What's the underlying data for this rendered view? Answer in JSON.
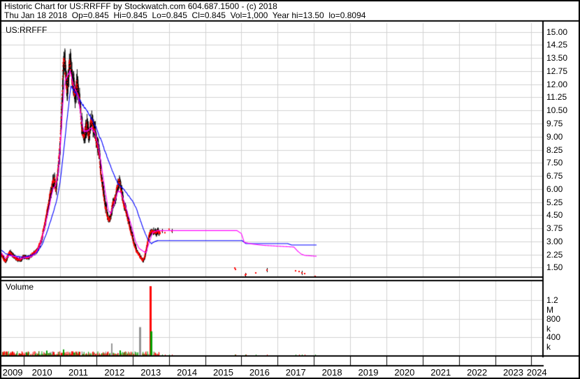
{
  "header": {
    "title": "Historic Chart for US:RRFFF by Stockwatch.com 604.687.1500 - (c) 2018",
    "quote_line": "Thu Jan 18 2018  Op=0.845  Hi=0.845  Lo=0.845  Cl=0.845  Vol=1,000  Year hi=13.50  lo=0.8094"
  },
  "chart": {
    "symbol_label": "US:RRFFF",
    "volume_label": "Volume"
  },
  "chart_data": {
    "type": "ohlc-with-volume",
    "symbol": "US:RRFFF",
    "grid": true,
    "xlim": [
      2009.38,
      2024.3
    ],
    "price_ylim": [
      1.0,
      15.5
    ],
    "volume_ylim": [
      0,
      1620000
    ],
    "years": [
      "2009",
      "2010",
      "2011",
      "2012",
      "2013",
      "2014",
      "2015",
      "2016",
      "2017",
      "2018",
      "2019",
      "2020",
      "2021",
      "2022",
      "2023",
      "2024"
    ],
    "price_ticks": [
      {
        "value": 15.0,
        "label": "15.00"
      },
      {
        "value": 14.25,
        "label": "14.25"
      },
      {
        "value": 13.5,
        "label": "13.50"
      },
      {
        "value": 12.75,
        "label": "12.75"
      },
      {
        "value": 12.0,
        "label": "12.00"
      },
      {
        "value": 11.25,
        "label": "11.25"
      },
      {
        "value": 10.5,
        "label": "10.50"
      },
      {
        "value": 9.75,
        "label": "9.75"
      },
      {
        "value": 9.0,
        "label": "9.00"
      },
      {
        "value": 8.25,
        "label": "8.25"
      },
      {
        "value": 7.5,
        "label": "7.50"
      },
      {
        "value": 6.75,
        "label": "6.75"
      },
      {
        "value": 6.0,
        "label": "6.00"
      },
      {
        "value": 5.25,
        "label": "5.25"
      },
      {
        "value": 4.5,
        "label": "4.50"
      },
      {
        "value": 3.75,
        "label": "3.75"
      },
      {
        "value": 3.0,
        "label": "3.00"
      },
      {
        "value": 2.25,
        "label": "2.25"
      },
      {
        "value": 1.5,
        "label": "1.50"
      }
    ],
    "volume_ticks": [
      {
        "value": 1200000,
        "label": "1.2 M"
      },
      {
        "value": 800000,
        "label": "800 k"
      },
      {
        "value": 400000,
        "label": "400 k"
      }
    ],
    "colors": {
      "bar": "#000000",
      "close_dot": "#ff0000",
      "ma_fast": "#ff00ff",
      "ma_slow": "#0000ff",
      "vol_up": "#00a000",
      "vol_down": "#ff0000",
      "vol_neutral": "#969696",
      "grid": "#d2d2d2",
      "border": "#000000"
    },
    "dense_range": [
      2009.38,
      2013.76
    ],
    "price_anchors": [
      [
        2009.38,
        2.3
      ],
      [
        2009.44,
        2.0
      ],
      [
        2009.5,
        1.85
      ],
      [
        2009.56,
        2.15
      ],
      [
        2009.62,
        2.4
      ],
      [
        2009.7,
        2.2
      ],
      [
        2009.8,
        2.0
      ],
      [
        2009.9,
        1.95
      ],
      [
        2010.0,
        2.15
      ],
      [
        2010.1,
        2.05
      ],
      [
        2010.2,
        2.2
      ],
      [
        2010.3,
        2.35
      ],
      [
        2010.4,
        2.6
      ],
      [
        2010.5,
        3.2
      ],
      [
        2010.6,
        4.3
      ],
      [
        2010.7,
        5.4
      ],
      [
        2010.78,
        6.3
      ],
      [
        2010.84,
        6.5
      ],
      [
        2010.88,
        5.9
      ],
      [
        2010.94,
        7.0
      ],
      [
        2011.0,
        8.8
      ],
      [
        2011.04,
        10.8
      ],
      [
        2011.08,
        12.8
      ],
      [
        2011.11,
        13.4
      ],
      [
        2011.15,
        12.3
      ],
      [
        2011.19,
        11.7
      ],
      [
        2011.24,
        12.9
      ],
      [
        2011.29,
        13.1
      ],
      [
        2011.34,
        12.1
      ],
      [
        2011.4,
        11.5
      ],
      [
        2011.46,
        12.1
      ],
      [
        2011.52,
        11.5
      ],
      [
        2011.57,
        10.3
      ],
      [
        2011.62,
        9.1
      ],
      [
        2011.67,
        8.8
      ],
      [
        2011.73,
        9.7
      ],
      [
        2011.79,
        9.1
      ],
      [
        2011.86,
        9.9
      ],
      [
        2011.93,
        9.4
      ],
      [
        2012.0,
        8.9
      ],
      [
        2012.08,
        7.7
      ],
      [
        2012.16,
        6.3
      ],
      [
        2012.24,
        5.1
      ],
      [
        2012.3,
        4.5
      ],
      [
        2012.36,
        4.1
      ],
      [
        2012.43,
        5.0
      ],
      [
        2012.5,
        5.4
      ],
      [
        2012.57,
        6.1
      ],
      [
        2012.63,
        6.5
      ],
      [
        2012.69,
        5.8
      ],
      [
        2012.76,
        5.2
      ],
      [
        2012.83,
        4.6
      ],
      [
        2012.9,
        4.0
      ],
      [
        2012.97,
        3.4
      ],
      [
        2013.05,
        2.8
      ],
      [
        2013.12,
        2.4
      ],
      [
        2013.2,
        2.15
      ],
      [
        2013.28,
        1.9
      ],
      [
        2013.34,
        2.2
      ],
      [
        2013.41,
        2.9
      ],
      [
        2013.47,
        3.4
      ],
      [
        2013.53,
        3.6
      ],
      [
        2013.6,
        3.5
      ],
      [
        2013.68,
        3.55
      ],
      [
        2013.76,
        3.5
      ]
    ],
    "ma_fast_magenta": [
      [
        2009.38,
        2.35
      ],
      [
        2009.5,
        2.05
      ],
      [
        2009.6,
        2.2
      ],
      [
        2009.75,
        2.15
      ],
      [
        2009.9,
        2.0
      ],
      [
        2010.05,
        2.08
      ],
      [
        2010.2,
        2.12
      ],
      [
        2010.32,
        2.3
      ],
      [
        2010.45,
        2.8
      ],
      [
        2010.58,
        3.8
      ],
      [
        2010.7,
        5.0
      ],
      [
        2010.8,
        6.0
      ],
      [
        2010.88,
        6.2
      ],
      [
        2010.95,
        6.9
      ],
      [
        2011.02,
        8.8
      ],
      [
        2011.08,
        11.0
      ],
      [
        2011.14,
        12.3
      ],
      [
        2011.2,
        12.5
      ],
      [
        2011.28,
        12.7
      ],
      [
        2011.35,
        12.1
      ],
      [
        2011.42,
        11.7
      ],
      [
        2011.5,
        11.3
      ],
      [
        2011.58,
        10.1
      ],
      [
        2011.65,
        9.3
      ],
      [
        2011.75,
        9.3
      ],
      [
        2011.85,
        9.5
      ],
      [
        2011.95,
        9.3
      ],
      [
        2012.05,
        8.5
      ],
      [
        2012.15,
        7.2
      ],
      [
        2012.25,
        5.8
      ],
      [
        2012.33,
        4.8
      ],
      [
        2012.4,
        4.6
      ],
      [
        2012.5,
        5.2
      ],
      [
        2012.6,
        5.9
      ],
      [
        2012.68,
        5.8
      ],
      [
        2012.78,
        5.2
      ],
      [
        2012.88,
        4.5
      ],
      [
        2012.98,
        3.8
      ],
      [
        2013.08,
        3.0
      ],
      [
        2013.18,
        2.6
      ],
      [
        2013.28,
        2.45
      ],
      [
        2013.37,
        2.35
      ],
      [
        2013.45,
        2.9
      ],
      [
        2013.55,
        3.5
      ],
      [
        2013.65,
        3.62
      ],
      [
        2015.88,
        3.62
      ],
      [
        2016.0,
        3.45
      ],
      [
        2016.08,
        2.95
      ],
      [
        2016.3,
        2.85
      ],
      [
        2016.6,
        2.78
      ],
      [
        2017.0,
        2.73
      ],
      [
        2017.45,
        2.68
      ],
      [
        2017.55,
        2.45
      ],
      [
        2017.65,
        2.28
      ],
      [
        2017.75,
        2.2
      ],
      [
        2018.08,
        2.15
      ]
    ],
    "ma_slow_blue": [
      [
        2009.38,
        2.5
      ],
      [
        2009.5,
        2.3
      ],
      [
        2009.65,
        2.2
      ],
      [
        2009.8,
        2.15
      ],
      [
        2010.0,
        2.1
      ],
      [
        2010.2,
        2.2
      ],
      [
        2010.35,
        2.35
      ],
      [
        2010.5,
        2.8
      ],
      [
        2010.65,
        3.6
      ],
      [
        2010.8,
        4.6
      ],
      [
        2010.9,
        5.3
      ],
      [
        2011.0,
        6.4
      ],
      [
        2011.1,
        8.2
      ],
      [
        2011.2,
        10.2
      ],
      [
        2011.3,
        11.9
      ],
      [
        2011.4,
        11.6
      ],
      [
        2011.55,
        11.1
      ],
      [
        2011.7,
        10.6
      ],
      [
        2011.85,
        10.1
      ],
      [
        2012.0,
        9.5
      ],
      [
        2012.15,
        8.7
      ],
      [
        2012.3,
        7.8
      ],
      [
        2012.45,
        7.0
      ],
      [
        2012.6,
        6.3
      ],
      [
        2012.75,
        6.0
      ],
      [
        2012.9,
        5.6
      ],
      [
        2013.0,
        5.3
      ],
      [
        2013.1,
        4.9
      ],
      [
        2013.2,
        4.3
      ],
      [
        2013.3,
        3.7
      ],
      [
        2013.42,
        3.1
      ],
      [
        2013.52,
        2.87
      ],
      [
        2013.62,
        3.0
      ],
      [
        2013.7,
        3.05
      ],
      [
        2016.02,
        3.05
      ],
      [
        2016.12,
        2.88
      ],
      [
        2017.27,
        2.88
      ],
      [
        2017.38,
        2.8
      ],
      [
        2018.08,
        2.8
      ]
    ],
    "sparse_trades": [
      [
        2013.82,
        3.6
      ],
      [
        2013.9,
        3.5
      ],
      [
        2014.0,
        3.7
      ],
      [
        2014.08,
        3.6
      ],
      [
        2015.81,
        1.48
      ],
      [
        2015.84,
        1.4
      ],
      [
        2016.1,
        1.08
      ],
      [
        2016.13,
        1.12
      ],
      [
        2016.4,
        1.2
      ],
      [
        2016.7,
        1.36
      ],
      [
        2017.5,
        1.32
      ],
      [
        2017.6,
        1.28
      ],
      [
        2017.66,
        1.2
      ],
      [
        2017.74,
        1.16
      ],
      [
        2018.04,
        1.0
      ]
    ],
    "volume_spikes": [
      {
        "t": 2009.67,
        "v": 95000,
        "color": "red"
      },
      {
        "t": 2010.05,
        "v": 70000,
        "color": "green"
      },
      {
        "t": 2010.62,
        "v": 115000,
        "color": "green"
      },
      {
        "t": 2010.8,
        "v": 85000,
        "color": "red"
      },
      {
        "t": 2011.08,
        "v": 140000,
        "color": "green"
      },
      {
        "t": 2011.3,
        "v": 100000,
        "color": "red"
      },
      {
        "t": 2011.52,
        "v": 90000,
        "color": "red"
      },
      {
        "t": 2012.4,
        "v": 270000,
        "color": "gray"
      },
      {
        "t": 2012.63,
        "v": 120000,
        "color": "green"
      },
      {
        "t": 2013.17,
        "v": 620000,
        "color": "gray"
      },
      {
        "t": 2013.46,
        "v": 1500000,
        "color": "red"
      },
      {
        "t": 2013.49,
        "v": 530000,
        "color": "green"
      }
    ]
  }
}
